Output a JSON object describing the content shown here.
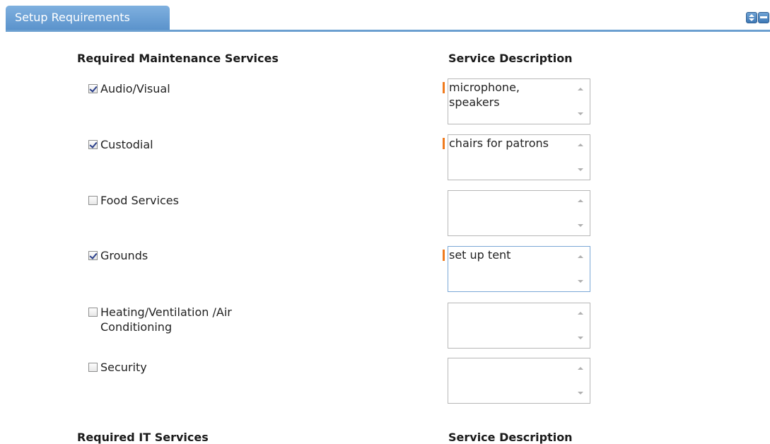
{
  "panel": {
    "title": "Setup Requirements"
  },
  "maintenance": {
    "heading": "Required Maintenance Services",
    "desc_heading": "Service Description",
    "items": [
      {
        "label": "Audio/Visual",
        "checked": true,
        "required": true,
        "description": "microphone,\nspeakers",
        "focused": false
      },
      {
        "label": "Custodial",
        "checked": true,
        "required": true,
        "description": "chairs for patrons",
        "focused": false
      },
      {
        "label": "Food Services",
        "checked": false,
        "required": false,
        "description": "",
        "focused": false
      },
      {
        "label": "Grounds",
        "checked": true,
        "required": true,
        "description": "set up tent",
        "focused": true
      },
      {
        "label": "Heating/Ventilation /Air Conditioning",
        "checked": false,
        "required": false,
        "description": "",
        "focused": false
      },
      {
        "label": "Security",
        "checked": false,
        "required": false,
        "description": "",
        "focused": false
      }
    ]
  },
  "it": {
    "heading": "Required IT Services",
    "desc_heading": "Service Description"
  },
  "colors": {
    "accent": "#5b93cc",
    "required_marker": "#f07b1e"
  },
  "icons": {
    "sort": "sort-icon",
    "collapse": "collapse-icon"
  }
}
